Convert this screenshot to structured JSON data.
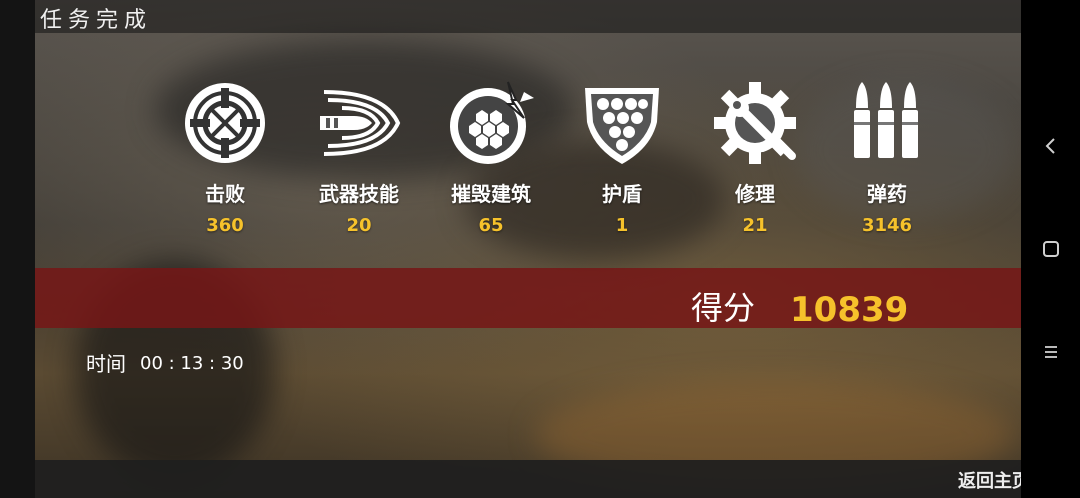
{
  "header": {
    "title": "任务完成"
  },
  "stats": [
    {
      "icon": "crosshair-icon",
      "label": "击败",
      "value": "360"
    },
    {
      "icon": "weapon-skill-icon",
      "label": "武器技能",
      "value": "20"
    },
    {
      "icon": "destroyed-building-icon",
      "label": "摧毁建筑",
      "value": "65"
    },
    {
      "icon": "shield-icon",
      "label": "护盾",
      "value": "1"
    },
    {
      "icon": "repair-gear-icon",
      "label": "修理",
      "value": "21"
    },
    {
      "icon": "ammo-icon",
      "label": "弹药",
      "value": "3146"
    }
  ],
  "score": {
    "label": "得分",
    "value": "10839"
  },
  "time": {
    "label": "时间",
    "value": "00 : 13 : 30"
  },
  "footer": {
    "home_label": "返回主页"
  },
  "colors": {
    "accent": "#f6c22b",
    "band": "#761616"
  }
}
